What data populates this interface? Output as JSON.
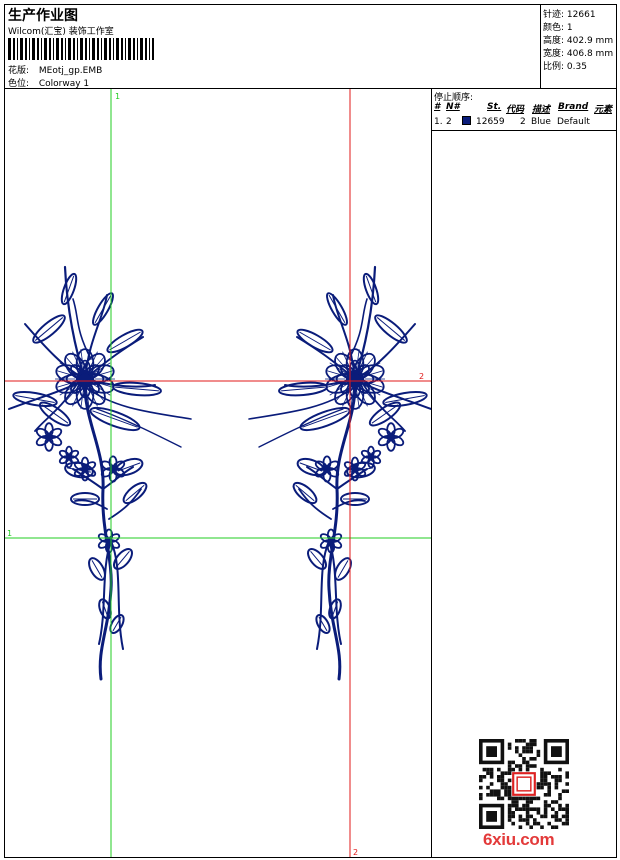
{
  "header": {
    "title": "生产作业图",
    "company": "Wilcom(汇宝) 装饰工作室",
    "pattern_label": "花版:",
    "pattern_value": "MEotj_gp.EMB",
    "colorway_label": "色位:",
    "colorway_value": "Colorway 1"
  },
  "stats": {
    "stitches_label": "针迹:",
    "stitches_value": "12661",
    "colors_label": "颜色:",
    "colors_value": "1",
    "height_label": "高度:",
    "height_value": "402.9 mm",
    "width_label": "宽度:",
    "width_value": "406.8 mm",
    "scale_label": "比例:",
    "scale_value": "0.35"
  },
  "stop_sequence": {
    "caption": "停止顺序:",
    "columns": [
      "#",
      "N#",
      "St.",
      "代码",
      "描述",
      "Brand",
      "元素"
    ],
    "rows": [
      {
        "num": "1.",
        "n": "2",
        "stitches": "12659",
        "code": "2",
        "desc": "Blue",
        "brand": "Default",
        "color": "#0a1c7a"
      }
    ]
  },
  "guides": {
    "green_label": "1",
    "red_label": "2",
    "green_color": "#22cc22",
    "red_color": "#e01818"
  },
  "embroidery": {
    "thread_color": "#0a1c7a"
  },
  "watermark": {
    "text": "6xiu.com",
    "color": "#e33a3a"
  }
}
